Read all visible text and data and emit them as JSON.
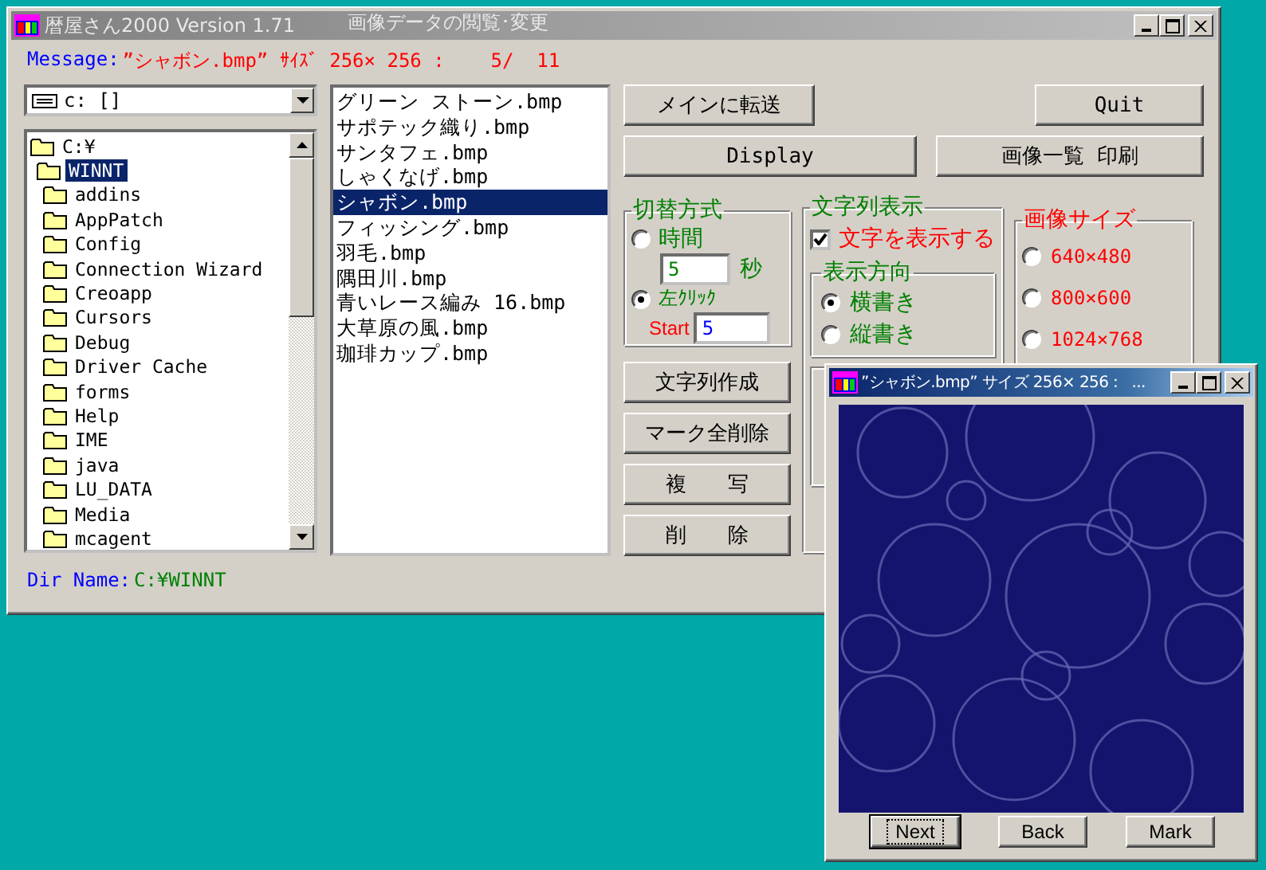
{
  "window": {
    "title": "暦屋さん2000 Version 1.71",
    "subtitle": "画像データの閲覧･変更"
  },
  "message": {
    "label": "Message:",
    "value": "”シャボン.bmp” ｻｲｽﾞ 256× 256 :    5/  11"
  },
  "drive": {
    "value": "c: []"
  },
  "tree": [
    {
      "label": "C:¥",
      "selected": false,
      "children": [
        {
          "label": "WINNT",
          "selected": true,
          "children": [
            {
              "label": "addins",
              "selected": false
            },
            {
              "label": "AppPatch",
              "selected": false
            },
            {
              "label": "Config",
              "selected": false
            },
            {
              "label": "Connection Wizard",
              "selected": false
            },
            {
              "label": "Creoapp",
              "selected": false
            },
            {
              "label": "Cursors",
              "selected": false
            },
            {
              "label": "Debug",
              "selected": false
            },
            {
              "label": "Driver Cache",
              "selected": false
            },
            {
              "label": "forms",
              "selected": false
            },
            {
              "label": "Help",
              "selected": false
            },
            {
              "label": "IME",
              "selected": false
            },
            {
              "label": "java",
              "selected": false
            },
            {
              "label": "LU_DATA",
              "selected": false
            },
            {
              "label": "Media",
              "selected": false
            },
            {
              "label": "mcagent",
              "selected": false
            }
          ]
        }
      ]
    }
  ],
  "files": [
    {
      "name": "グリーン ストーン.bmp",
      "selected": false
    },
    {
      "name": "サポテック織り.bmp",
      "selected": false
    },
    {
      "name": "サンタフェ.bmp",
      "selected": false
    },
    {
      "name": "しゃくなげ.bmp",
      "selected": false
    },
    {
      "name": "シャボン.bmp",
      "selected": true
    },
    {
      "name": "フィッシング.bmp",
      "selected": false
    },
    {
      "name": "羽毛.bmp",
      "selected": false
    },
    {
      "name": "隅田川.bmp",
      "selected": false
    },
    {
      "name": "青いレース編み 16.bmp",
      "selected": false
    },
    {
      "name": "大草原の風.bmp",
      "selected": false
    },
    {
      "name": "珈琲カップ.bmp",
      "selected": false
    }
  ],
  "dir": {
    "label": "Dir Name:",
    "value": "C:¥WINNT"
  },
  "top_buttons": [
    "メインに転送",
    "Quit"
  ],
  "wide_buttons": [
    "Display",
    "画像一覧 印刷"
  ],
  "side_buttons": [
    "文字列作成",
    "マーク全削除",
    "複　　写",
    "削　　除"
  ],
  "switch_mode": {
    "title": "切替方式",
    "options": [
      {
        "label": "時間",
        "selected": false
      },
      {
        "label": "左ｸﾘｯｸ",
        "selected": true
      }
    ],
    "seconds": {
      "value": "5",
      "unit": "秒"
    },
    "start": {
      "label": "Start",
      "value": "5"
    }
  },
  "text_display": {
    "title": "文字列表示",
    "show_text": {
      "label": "文字を表示する",
      "checked": true
    },
    "direction": {
      "title": "表示方向",
      "options": [
        {
          "label": "横書き",
          "selected": true
        },
        {
          "label": "縦書き",
          "selected": false
        }
      ]
    }
  },
  "image_size": {
    "title": "画像サイズ",
    "options": [
      {
        "label": "640×480",
        "selected": false
      },
      {
        "label": "800×600",
        "selected": false
      },
      {
        "label": "1024×768",
        "selected": false
      }
    ]
  },
  "viewer": {
    "title": "”シャボン.bmp” サイズ 256× 256 :   ...",
    "buttons": [
      {
        "label": "Next",
        "focused": true
      },
      {
        "label": "Back",
        "focused": false
      },
      {
        "label": "Mark",
        "focused": false
      }
    ]
  }
}
